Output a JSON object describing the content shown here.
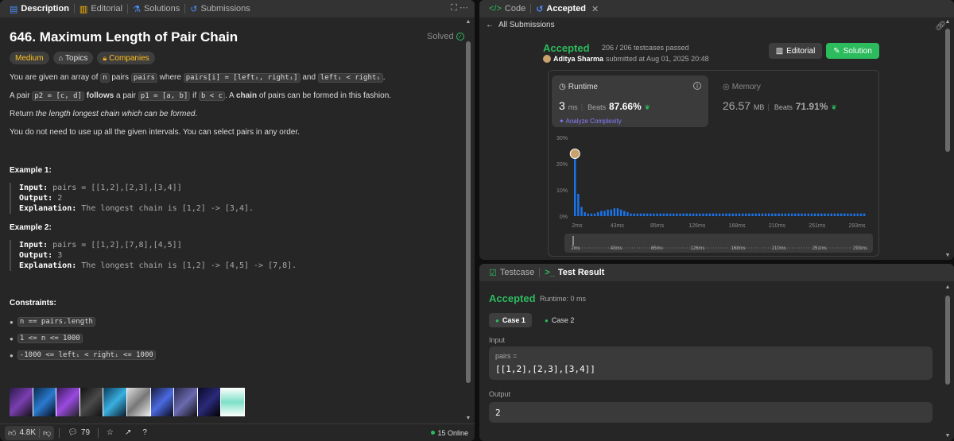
{
  "left": {
    "tabs": [
      {
        "label": "Description",
        "icon": "document-icon"
      },
      {
        "label": "Editorial",
        "icon": "book-icon"
      },
      {
        "label": "Solutions",
        "icon": "flask-icon"
      },
      {
        "label": "Submissions",
        "icon": "history-icon"
      }
    ],
    "title": "646. Maximum Length of Pair Chain",
    "solved_label": "Solved",
    "chips": {
      "difficulty": "Medium",
      "topics": "Topics",
      "companies": "Companies"
    },
    "p1": {
      "a": "You are given an array of ",
      "c1": "n",
      "b": " pairs ",
      "c2": "pairs",
      "c": " where ",
      "c3": "pairs[i] = [leftᵢ, rightᵢ]",
      "d": " and ",
      "c4": "leftᵢ < rightᵢ",
      "e": "."
    },
    "p2": {
      "a": "A pair ",
      "c1": "p2 = [c, d]",
      "b1": " ",
      "bold1": "follows",
      "b2": " a pair ",
      "c2": "p1 = [a, b]",
      "c": " if ",
      "c3": "b < c",
      "d": ". A ",
      "bold2": "chain",
      "e": " of pairs can be formed in this fashion."
    },
    "p3": {
      "a": "Return ",
      "em": "the length longest chain which can be formed",
      "b": "."
    },
    "p4": "You do not need to use up all the given intervals. You can select pairs in any order.",
    "example1": {
      "title": "Example 1:",
      "input_label": "Input:",
      "input": "pairs = [[1,2],[2,3],[3,4]]",
      "output_label": "Output:",
      "output": "2",
      "explanation_label": "Explanation:",
      "explanation": "The longest chain is [1,2] -> [3,4]."
    },
    "example2": {
      "title": "Example 2:",
      "input_label": "Input:",
      "input": "pairs = [[1,2],[7,8],[4,5]]",
      "output_label": "Output:",
      "output": "3",
      "explanation_label": "Explanation:",
      "explanation": "The longest chain is [1,2] -> [4,5] -> [7,8]."
    },
    "constraints_title": "Constraints:",
    "constraints": [
      "n == pairs.length",
      "1 <= n <= 1000",
      "-1000 <= leftᵢ < rightᵢ <= 1000"
    ],
    "bottom": {
      "likes": "4.8K",
      "comments": "79",
      "online": "15 Online"
    }
  },
  "right_top": {
    "tabs": [
      {
        "label": "Code",
        "icon": "code-icon"
      },
      {
        "label": "Accepted",
        "icon": "history-icon"
      }
    ],
    "back_label": "All Submissions",
    "status": "Accepted",
    "passed": "206 / 206 testcases passed",
    "submitter_name": "Aditya Sharma",
    "submitted_at": "submitted at Aug 01, 2025 20:48",
    "editorial_btn": "Editorial",
    "solution_btn": "Solution",
    "runtime": {
      "label": "Runtime",
      "value": "3",
      "unit": "ms",
      "beats_label": "Beats",
      "beats": "87.66%",
      "analyze": "Analyze Complexity"
    },
    "memory": {
      "label": "Memory",
      "value": "26.57",
      "unit": "MB",
      "beats_label": "Beats",
      "beats": "71.91%"
    }
  },
  "chart_data": {
    "type": "bar",
    "yticks": [
      "30%",
      "20%",
      "10%",
      "0%"
    ],
    "ylim": [
      0,
      30
    ],
    "xticks": [
      "2ms",
      "43ms",
      "85ms",
      "126ms",
      "168ms",
      "210ms",
      "251ms",
      "293ms"
    ],
    "values": [
      25,
      8.5,
      3.5,
      1.5,
      1,
      1,
      1,
      1.5,
      2,
      2,
      2.5,
      2.5,
      3,
      3,
      2.5,
      2,
      1.5,
      1,
      1,
      1,
      1,
      1,
      1,
      1,
      1,
      1,
      1,
      1,
      1,
      1,
      1,
      1,
      1,
      1,
      1,
      1,
      1,
      1,
      1,
      1,
      1,
      1,
      1,
      1,
      1,
      1,
      1,
      1,
      1,
      1,
      1,
      1,
      1,
      1,
      1,
      1,
      1,
      1,
      1,
      1,
      1,
      1,
      1,
      1,
      1,
      1,
      1,
      1,
      1,
      1,
      1,
      1,
      1,
      1,
      1,
      1,
      1,
      1,
      1,
      1,
      1,
      1,
      1,
      1,
      1,
      1,
      1,
      1,
      1
    ],
    "highlight_index": 0,
    "bar_color": "#1a73e8"
  },
  "right_bottom": {
    "tabs": [
      {
        "label": "Testcase",
        "icon": "checkbox-icon"
      },
      {
        "label": "Test Result",
        "icon": "terminal-icon"
      }
    ],
    "status": "Accepted",
    "runtime": "Runtime: 0 ms",
    "cases": [
      "Case 1",
      "Case 2"
    ],
    "input_label": "Input",
    "input_var": "pairs =",
    "input_value": "[[1,2],[2,3],[3,4]]",
    "output_label": "Output",
    "output_value": "2"
  }
}
